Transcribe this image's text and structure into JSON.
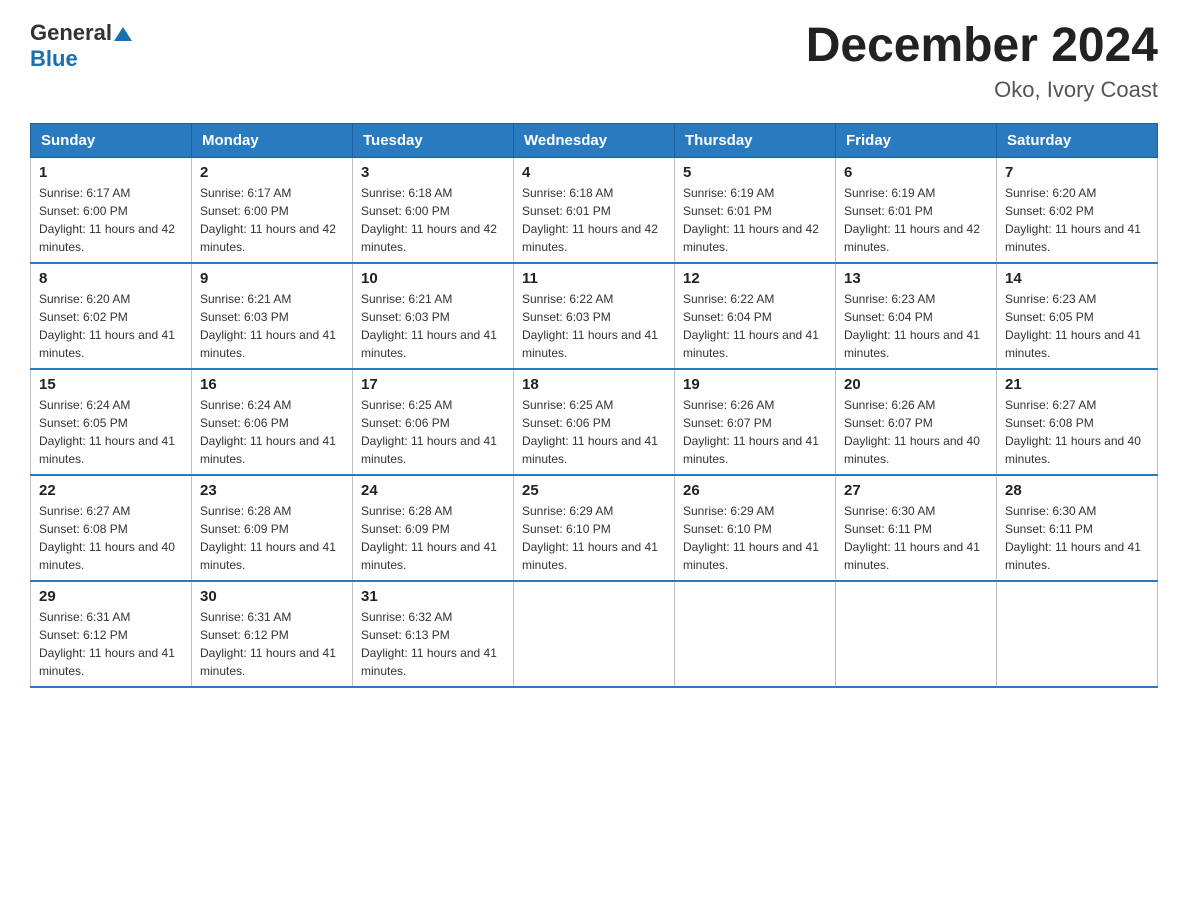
{
  "header": {
    "logo_general": "General",
    "logo_blue": "Blue",
    "month_title": "December 2024",
    "location": "Oko, Ivory Coast"
  },
  "weekdays": [
    "Sunday",
    "Monday",
    "Tuesday",
    "Wednesday",
    "Thursday",
    "Friday",
    "Saturday"
  ],
  "weeks": [
    [
      {
        "day": "1",
        "sunrise": "6:17 AM",
        "sunset": "6:00 PM",
        "daylight": "11 hours and 42 minutes."
      },
      {
        "day": "2",
        "sunrise": "6:17 AM",
        "sunset": "6:00 PM",
        "daylight": "11 hours and 42 minutes."
      },
      {
        "day": "3",
        "sunrise": "6:18 AM",
        "sunset": "6:00 PM",
        "daylight": "11 hours and 42 minutes."
      },
      {
        "day": "4",
        "sunrise": "6:18 AM",
        "sunset": "6:01 PM",
        "daylight": "11 hours and 42 minutes."
      },
      {
        "day": "5",
        "sunrise": "6:19 AM",
        "sunset": "6:01 PM",
        "daylight": "11 hours and 42 minutes."
      },
      {
        "day": "6",
        "sunrise": "6:19 AM",
        "sunset": "6:01 PM",
        "daylight": "11 hours and 42 minutes."
      },
      {
        "day": "7",
        "sunrise": "6:20 AM",
        "sunset": "6:02 PM",
        "daylight": "11 hours and 41 minutes."
      }
    ],
    [
      {
        "day": "8",
        "sunrise": "6:20 AM",
        "sunset": "6:02 PM",
        "daylight": "11 hours and 41 minutes."
      },
      {
        "day": "9",
        "sunrise": "6:21 AM",
        "sunset": "6:03 PM",
        "daylight": "11 hours and 41 minutes."
      },
      {
        "day": "10",
        "sunrise": "6:21 AM",
        "sunset": "6:03 PM",
        "daylight": "11 hours and 41 minutes."
      },
      {
        "day": "11",
        "sunrise": "6:22 AM",
        "sunset": "6:03 PM",
        "daylight": "11 hours and 41 minutes."
      },
      {
        "day": "12",
        "sunrise": "6:22 AM",
        "sunset": "6:04 PM",
        "daylight": "11 hours and 41 minutes."
      },
      {
        "day": "13",
        "sunrise": "6:23 AM",
        "sunset": "6:04 PM",
        "daylight": "11 hours and 41 minutes."
      },
      {
        "day": "14",
        "sunrise": "6:23 AM",
        "sunset": "6:05 PM",
        "daylight": "11 hours and 41 minutes."
      }
    ],
    [
      {
        "day": "15",
        "sunrise": "6:24 AM",
        "sunset": "6:05 PM",
        "daylight": "11 hours and 41 minutes."
      },
      {
        "day": "16",
        "sunrise": "6:24 AM",
        "sunset": "6:06 PM",
        "daylight": "11 hours and 41 minutes."
      },
      {
        "day": "17",
        "sunrise": "6:25 AM",
        "sunset": "6:06 PM",
        "daylight": "11 hours and 41 minutes."
      },
      {
        "day": "18",
        "sunrise": "6:25 AM",
        "sunset": "6:06 PM",
        "daylight": "11 hours and 41 minutes."
      },
      {
        "day": "19",
        "sunrise": "6:26 AM",
        "sunset": "6:07 PM",
        "daylight": "11 hours and 41 minutes."
      },
      {
        "day": "20",
        "sunrise": "6:26 AM",
        "sunset": "6:07 PM",
        "daylight": "11 hours and 40 minutes."
      },
      {
        "day": "21",
        "sunrise": "6:27 AM",
        "sunset": "6:08 PM",
        "daylight": "11 hours and 40 minutes."
      }
    ],
    [
      {
        "day": "22",
        "sunrise": "6:27 AM",
        "sunset": "6:08 PM",
        "daylight": "11 hours and 40 minutes."
      },
      {
        "day": "23",
        "sunrise": "6:28 AM",
        "sunset": "6:09 PM",
        "daylight": "11 hours and 41 minutes."
      },
      {
        "day": "24",
        "sunrise": "6:28 AM",
        "sunset": "6:09 PM",
        "daylight": "11 hours and 41 minutes."
      },
      {
        "day": "25",
        "sunrise": "6:29 AM",
        "sunset": "6:10 PM",
        "daylight": "11 hours and 41 minutes."
      },
      {
        "day": "26",
        "sunrise": "6:29 AM",
        "sunset": "6:10 PM",
        "daylight": "11 hours and 41 minutes."
      },
      {
        "day": "27",
        "sunrise": "6:30 AM",
        "sunset": "6:11 PM",
        "daylight": "11 hours and 41 minutes."
      },
      {
        "day": "28",
        "sunrise": "6:30 AM",
        "sunset": "6:11 PM",
        "daylight": "11 hours and 41 minutes."
      }
    ],
    [
      {
        "day": "29",
        "sunrise": "6:31 AM",
        "sunset": "6:12 PM",
        "daylight": "11 hours and 41 minutes."
      },
      {
        "day": "30",
        "sunrise": "6:31 AM",
        "sunset": "6:12 PM",
        "daylight": "11 hours and 41 minutes."
      },
      {
        "day": "31",
        "sunrise": "6:32 AM",
        "sunset": "6:13 PM",
        "daylight": "11 hours and 41 minutes."
      },
      null,
      null,
      null,
      null
    ]
  ]
}
